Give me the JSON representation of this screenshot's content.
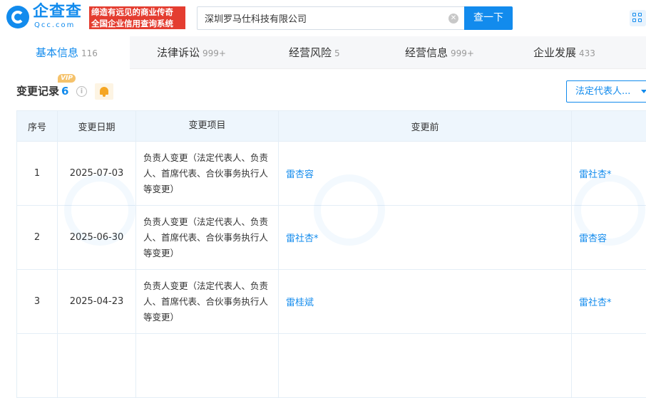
{
  "header": {
    "logo_cn": "企查查",
    "logo_en": "Qcc.com",
    "slogan_line1": "缔造有远见的商业传奇",
    "slogan_line2": "全国企业信用查询系统",
    "search_value": "深圳罗马仕科技有限公司",
    "search_button": "查一下"
  },
  "tabs": [
    {
      "label": "基本信息",
      "count": "116"
    },
    {
      "label": "法律诉讼",
      "count": "999+"
    },
    {
      "label": "经营风险",
      "count": "5"
    },
    {
      "label": "经营信息",
      "count": "999+"
    },
    {
      "label": "企业发展",
      "count": "433"
    }
  ],
  "section": {
    "title": "变更记录",
    "count": "6",
    "vip_badge": "VIP",
    "filter_label": "法定代表人..."
  },
  "table": {
    "headers": [
      "序号",
      "变更日期",
      "变更项目",
      "变更前",
      ""
    ],
    "rows": [
      {
        "idx": "1",
        "date": "2025-07-03",
        "item": "负责人变更（法定代表人、负责人、首席代表、合伙事务执行人等变更）",
        "before": "雷杏容",
        "after": "雷社杏*"
      },
      {
        "idx": "2",
        "date": "2025-06-30",
        "item": "负责人变更（法定代表人、负责人、首席代表、合伙事务执行人等变更）",
        "before": "雷社杏*",
        "after": "雷杏容"
      },
      {
        "idx": "3",
        "date": "2025-04-23",
        "item": "负责人变更（法定代表人、负责人、首席代表、合伙事务执行人等变更）",
        "before": "雷桂斌",
        "after": "雷社杏*"
      }
    ]
  },
  "icons": {
    "logo": "qcc-logo-icon",
    "clear": "clear-icon",
    "apps": "apps-icon",
    "info": "info-icon",
    "bell": "bell-icon",
    "caret": "chevron-down-icon"
  },
  "colors": {
    "brand": "#128bed",
    "slogan_bg": "#e43d30",
    "vip": "#f5c26b",
    "bell": "#f5a623"
  }
}
